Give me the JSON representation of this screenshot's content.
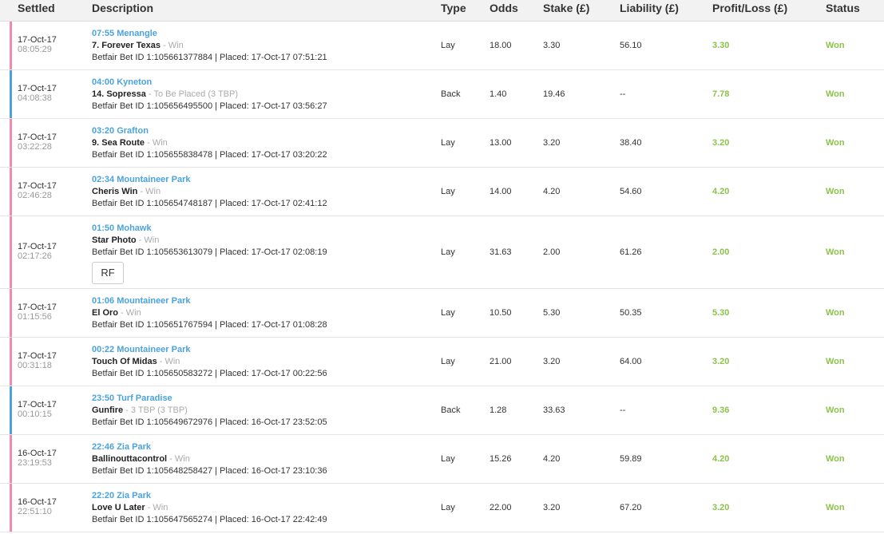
{
  "headers": {
    "settled": "Settled",
    "description": "Description",
    "type": "Type",
    "odds": "Odds",
    "stake": "Stake (£)",
    "liability": "Liability (£)",
    "profit": "Profit/Loss (£)",
    "status": "Status"
  },
  "colors": {
    "lay": "#f28bab",
    "back": "#4aa3df",
    "won": "#8bc34a",
    "link": "#4aa3df"
  },
  "rows": [
    {
      "kind": "lay",
      "date": "17-Oct-17",
      "time": "08:05:29",
      "venue": "07:55 Menangle",
      "selection": "7. Forever Texas",
      "market": "Win",
      "betinfo": "Betfair Bet ID 1:105661377884 | Placed: 17-Oct-17 07:51:21",
      "type": "Lay",
      "odds": "18.00",
      "stake": "3.30",
      "liability": "56.10",
      "profit": "3.30",
      "status": "Won"
    },
    {
      "kind": "back",
      "date": "17-Oct-17",
      "time": "04:08:38",
      "venue": "04:00 Kyneton",
      "selection": "14. Sopressa",
      "market": "To Be Placed (3 TBP)",
      "betinfo": "Betfair Bet ID 1:105656495500 | Placed: 17-Oct-17 03:56:27",
      "type": "Back",
      "odds": "1.40",
      "stake": "19.46",
      "liability": "--",
      "profit": "7.78",
      "status": "Won"
    },
    {
      "kind": "lay",
      "date": "17-Oct-17",
      "time": "03:22:28",
      "venue": "03:20 Grafton",
      "selection": "9. Sea Route",
      "market": "Win",
      "betinfo": "Betfair Bet ID 1:105655838478 | Placed: 17-Oct-17 03:20:22",
      "type": "Lay",
      "odds": "13.00",
      "stake": "3.20",
      "liability": "38.40",
      "profit": "3.20",
      "status": "Won"
    },
    {
      "kind": "lay",
      "date": "17-Oct-17",
      "time": "02:46:28",
      "venue": "02:34 Mountaineer Park",
      "selection": "Cheris Win",
      "market": "Win",
      "betinfo": "Betfair Bet ID 1:105654748187 | Placed: 17-Oct-17 02:41:12",
      "type": "Lay",
      "odds": "14.00",
      "stake": "4.20",
      "liability": "54.60",
      "profit": "4.20",
      "status": "Won"
    },
    {
      "kind": "lay",
      "date": "17-Oct-17",
      "time": "02:17:26",
      "venue": "01:50 Mohawk",
      "selection": "Star Photo",
      "market": "Win",
      "betinfo": "Betfair Bet ID 1:105653613079 | Placed: 17-Oct-17 02:08:19",
      "type": "Lay",
      "odds": "31.63",
      "stake": "2.00",
      "liability": "61.26",
      "profit": "2.00",
      "status": "Won",
      "rf": "RF"
    },
    {
      "kind": "lay",
      "date": "17-Oct-17",
      "time": "01:15:56",
      "venue": "01:06 Mountaineer Park",
      "selection": "El Oro",
      "market": "Win",
      "betinfo": "Betfair Bet ID 1:105651767594 | Placed: 17-Oct-17 01:08:28",
      "type": "Lay",
      "odds": "10.50",
      "stake": "5.30",
      "liability": "50.35",
      "profit": "5.30",
      "status": "Won"
    },
    {
      "kind": "lay",
      "date": "17-Oct-17",
      "time": "00:31:18",
      "venue": "00:22 Mountaineer Park",
      "selection": "Touch Of Midas",
      "market": "Win",
      "betinfo": "Betfair Bet ID 1:105650583272 | Placed: 17-Oct-17 00:22:56",
      "type": "Lay",
      "odds": "21.00",
      "stake": "3.20",
      "liability": "64.00",
      "profit": "3.20",
      "status": "Won"
    },
    {
      "kind": "back",
      "date": "17-Oct-17",
      "time": "00:10:15",
      "venue": "23:50 Turf Paradise",
      "selection": "Gunfire",
      "market": "3 TBP (3 TBP)",
      "betinfo": "Betfair Bet ID 1:105649672976 | Placed: 16-Oct-17 23:52:05",
      "type": "Back",
      "odds": "1.28",
      "stake": "33.63",
      "liability": "--",
      "profit": "9.36",
      "status": "Won"
    },
    {
      "kind": "lay",
      "date": "16-Oct-17",
      "time": "23:19:53",
      "venue": "22:46 Zia Park",
      "selection": "Ballinouttacontrol",
      "market": "Win",
      "betinfo": "Betfair Bet ID 1:105648258427 | Placed: 16-Oct-17 23:10:36",
      "type": "Lay",
      "odds": "15.26",
      "stake": "4.20",
      "liability": "59.89",
      "profit": "4.20",
      "status": "Won"
    },
    {
      "kind": "lay",
      "date": "16-Oct-17",
      "time": "22:51:10",
      "venue": "22:20 Zia Park",
      "selection": "Love U Later",
      "market": "Win",
      "betinfo": "Betfair Bet ID 1:105647565274 | Placed: 16-Oct-17 22:42:49",
      "type": "Lay",
      "odds": "22.00",
      "stake": "3.20",
      "liability": "67.20",
      "profit": "3.20",
      "status": "Won"
    }
  ]
}
